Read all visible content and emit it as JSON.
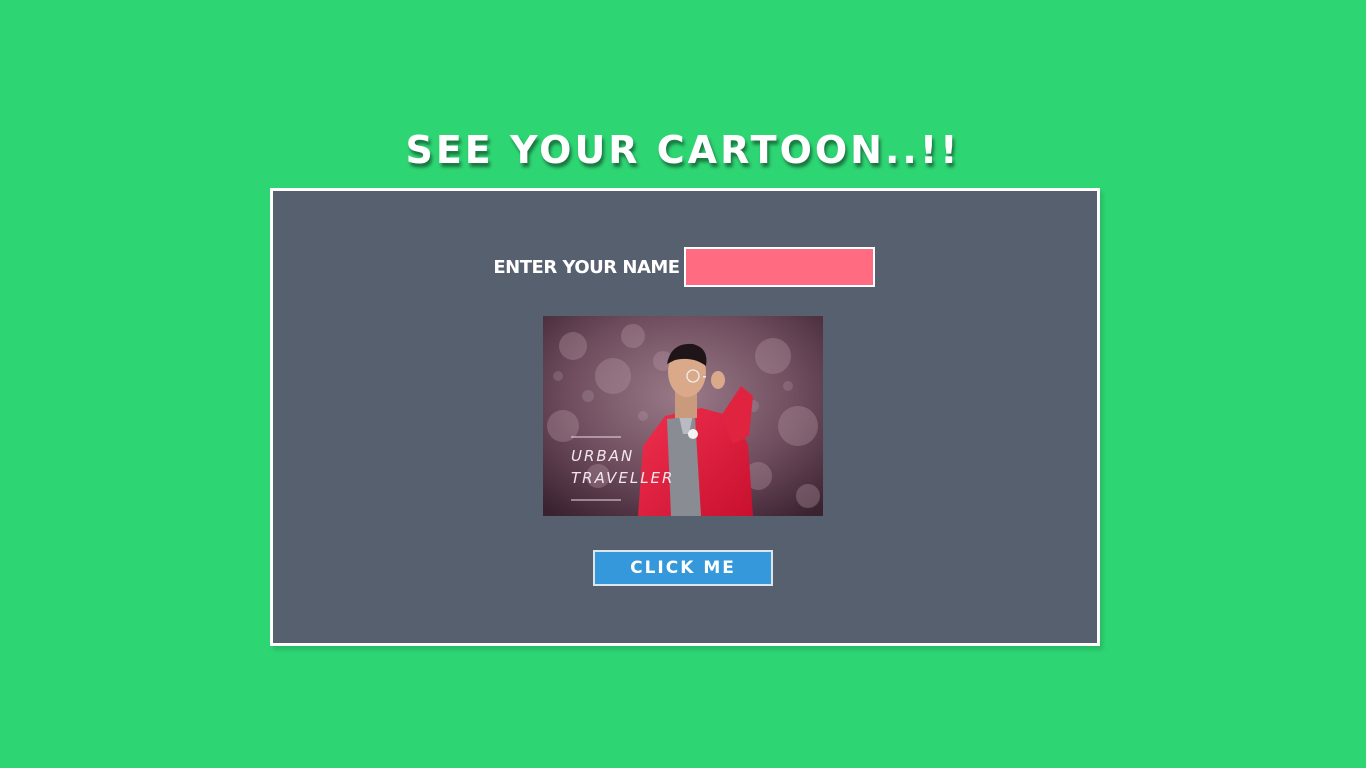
{
  "title": "SEE YOUR CARTOON..!!",
  "form": {
    "name_label": "ENTER YOUR NAME",
    "name_value": "",
    "button_label": "CLICK ME"
  },
  "photo": {
    "line1": "URBAN",
    "line2": "TRAVELLER"
  },
  "colors": {
    "background": "#2ed573",
    "panel": "#57606f",
    "input": "#ff6b81",
    "button": "#3498db"
  }
}
